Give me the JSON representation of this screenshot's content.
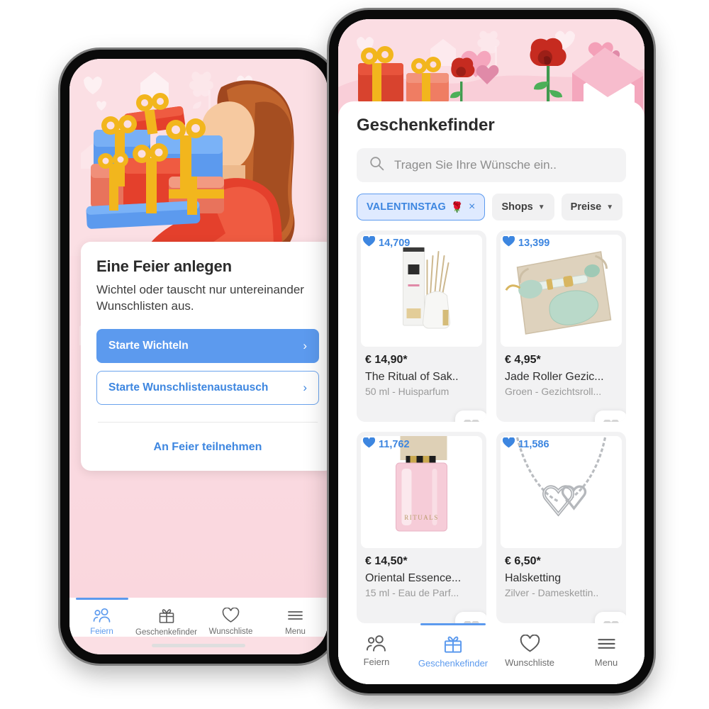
{
  "left_phone": {
    "hero_alt": "woman-carrying-gifts-illustration",
    "card": {
      "title": "Eine Feier anlegen",
      "description": "Wichtel oder tauscht nur untereinander Wunschlisten aus.",
      "primary_button": "Starte Wichteln",
      "secondary_button": "Starte Wunschlistenaustausch",
      "chevron": "›",
      "join_link": "An Feier teilnehmen"
    },
    "nav": [
      {
        "label": "Feiern",
        "icon": "people-icon",
        "active": true
      },
      {
        "label": "Geschenkefinder",
        "icon": "gift-icon",
        "active": false
      },
      {
        "label": "Wunschliste",
        "icon": "heart-icon",
        "active": false
      },
      {
        "label": "Menu",
        "icon": "hamburger-icon",
        "active": false
      }
    ]
  },
  "right_phone": {
    "banner_alt": "valentines-gifts-roses-hearts-banner",
    "title": "Geschenkefinder",
    "search": {
      "placeholder": "Tragen Sie Ihre Wünsche ein..",
      "value": "",
      "icon": "search-icon"
    },
    "filters": [
      {
        "label": "VALENTINSTAG",
        "emoji": "🌹",
        "selected": true,
        "remove": "×"
      },
      {
        "label": "Shops",
        "selected": false,
        "caret": "▼"
      },
      {
        "label": "Preise",
        "selected": false,
        "caret": "▼"
      }
    ],
    "products": [
      {
        "likes": "14,709",
        "price": "€ 14,90*",
        "title": "The Ritual of Sak..",
        "subtitle": "50 ml - Huisparfum",
        "image": "reed-diffuser"
      },
      {
        "likes": "13,399",
        "price": "€ 4,95*",
        "title": "Jade Roller Gezic...",
        "subtitle": "Groen - Gezichtsroll...",
        "image": "jade-roller"
      },
      {
        "likes": "11,762",
        "price": "€ 14,50*",
        "title": "Oriental Essence...",
        "subtitle": "15 ml - Eau de Parf...",
        "image": "pink-perfume-bottle"
      },
      {
        "likes": "11,586",
        "price": "€ 6,50*",
        "title": "Halsketting",
        "subtitle": "Zilver - Dameskettin..",
        "image": "heart-necklace"
      }
    ],
    "nav": [
      {
        "label": "Feiern",
        "icon": "people-icon",
        "active": false
      },
      {
        "label": "Geschenkefinder",
        "icon": "gift-icon",
        "active": true
      },
      {
        "label": "Wunschliste",
        "icon": "heart-icon",
        "active": false
      },
      {
        "label": "Menu",
        "icon": "hamburger-icon",
        "active": false
      }
    ]
  },
  "colors": {
    "accent_blue": "#5c9aee",
    "link_blue": "#3d86e0",
    "pink_bg": "#fbdfe4",
    "card_grey": "#f2f2f3",
    "muted_text": "#9a9a9a"
  }
}
